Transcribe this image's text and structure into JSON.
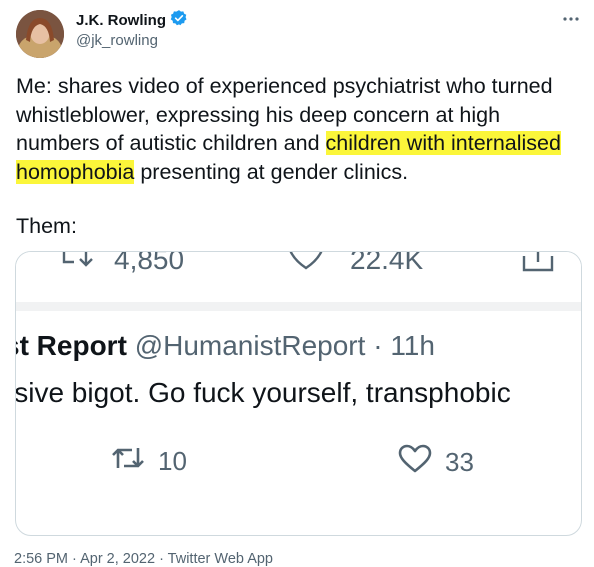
{
  "author": {
    "display_name": "J.K. Rowling",
    "handle": "@jk_rowling",
    "verified_icon": "verified-badge-icon",
    "more_icon": "more-options-icon"
  },
  "tweet": {
    "text_part1": "Me: shares video of experienced psychiatrist who turned whistleblower, expressing his deep concern at high numbers of autistic children and ",
    "highlight": "children with internalised homophobia",
    "text_part2": " presenting at gender clinics.",
    "them": "Them:",
    "highlight_color": "#fbf63a"
  },
  "screenshot": {
    "top_stats": {
      "reply_count": "4,850",
      "like_count": "22.4K"
    },
    "quoted": {
      "name": "st Report",
      "handle": "@HumanistReport",
      "separator": " · ",
      "time": "11h",
      "text": "lsive bigot. Go fuck yourself, transphobic"
    },
    "actions": {
      "retweet_count": "10",
      "like_count": "33"
    }
  },
  "footer": {
    "timestamp": "2:56 PM · Apr 2, 2022 · Twitter Web App"
  },
  "colors": {
    "text": "#0f1419",
    "secondary": "#536471",
    "verified": "#1d9bf0",
    "border": "#cfd9de"
  }
}
